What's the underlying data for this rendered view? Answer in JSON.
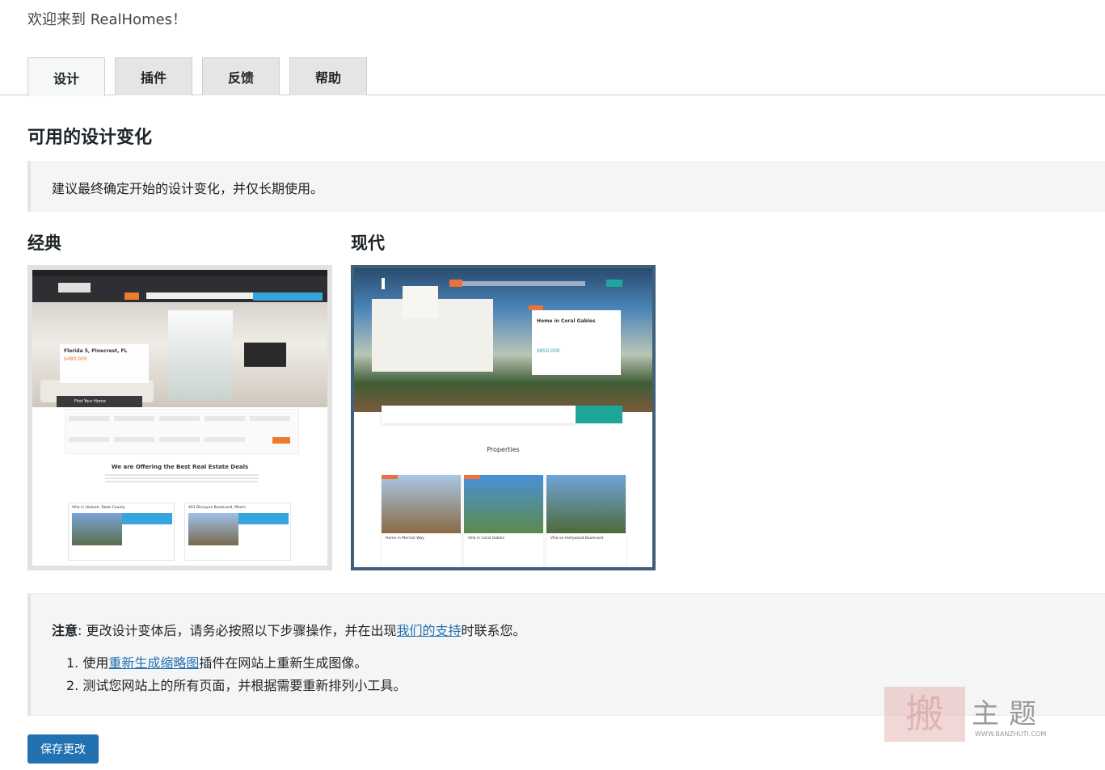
{
  "welcome": "欢迎来到 RealHomes！",
  "tabs": [
    {
      "label": "设计",
      "active": true
    },
    {
      "label": "插件",
      "active": false
    },
    {
      "label": "反馈",
      "active": false
    },
    {
      "label": "帮助",
      "active": false
    }
  ],
  "section": {
    "title": "可用的设计变化",
    "notice": "建议最终确定开始的设计变化，并仅长期使用。"
  },
  "variants": {
    "classic": {
      "label": "经典",
      "preview": {
        "card_title": "Florida 5, Pinecrest, FL",
        "card_price": "$480,000",
        "search_head": "Find Your Home",
        "offer_title": "We are Offering the Best Real Estate Deals",
        "listing1": "Villa in Hialeah, Dade County",
        "listing2": "401 Biscayne Boulevard, Miami"
      }
    },
    "modern": {
      "label": "现代",
      "preview": {
        "card_title": "Home in Coral Gables",
        "card_price": "$850,000",
        "props_label": "Properties",
        "prop1": "Home in Merrick Way",
        "prop2": "Villa in Coral Gables",
        "prop3": "Villa on Hollywood Boulevard"
      }
    }
  },
  "note": {
    "bold": "注意",
    "text_before": ": 更改设计变体后，请务必按照以下步骤操作，并在出现",
    "link": "我们的支持",
    "text_after": "时联系您。",
    "step1_prefix": "1. 使用",
    "step1_link": "重新生成缩略图",
    "step1_suffix": "插件在网站上重新生成图像。",
    "step2": "2. 测试您网站上的所有页面，并根据需要重新排列小工具。"
  },
  "save_label": "保存更改",
  "watermark": {
    "seal": "搬",
    "text": "主题",
    "sub": "WWW.BANZHUTI.COM"
  }
}
